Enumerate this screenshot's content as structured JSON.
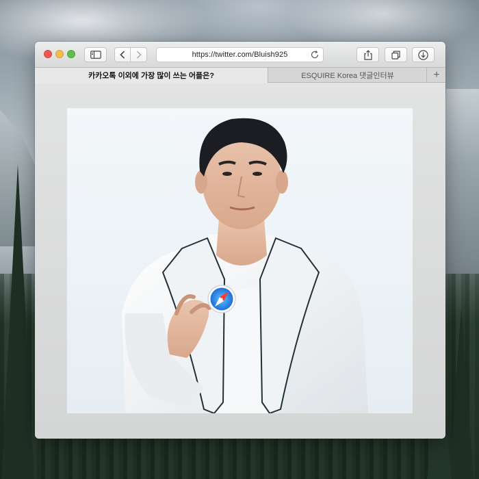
{
  "window": {
    "url": "https://twitter.com/Bluish925"
  },
  "tabs": [
    {
      "label": "카카오톡 이외에 가장 많이 쓰는 어플은?",
      "active": true
    },
    {
      "label": "ESQUIRE Korea 댓글인터뷰",
      "active": false
    }
  ],
  "new_tab_symbol": "+",
  "icons": {
    "sidebar": "sidebar-icon",
    "back": "chevron-left-icon",
    "forward": "chevron-right-icon",
    "reload": "reload-icon",
    "share": "share-icon",
    "tabs": "tabs-overview-icon",
    "download": "download-icon",
    "safari": "safari-compass-icon"
  },
  "colors": {
    "close": "#ee5a52",
    "minimize": "#f5bd4f",
    "zoom": "#5fbf4a",
    "safari_blue": "#1e88e5"
  }
}
